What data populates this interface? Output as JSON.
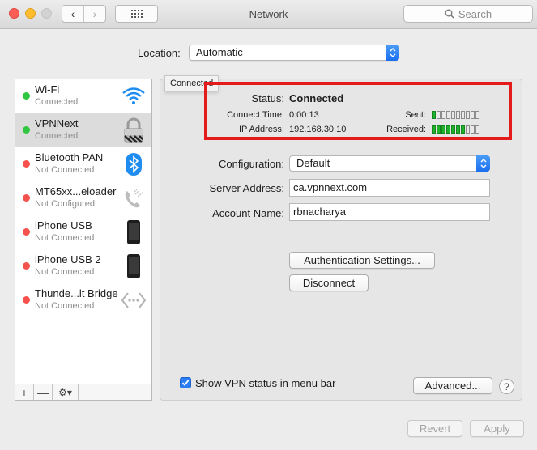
{
  "window": {
    "title": "Network",
    "search_placeholder": "Search",
    "back_glyph": "‹",
    "forward_glyph": "›"
  },
  "location": {
    "label": "Location:",
    "value": "Automatic"
  },
  "tooltip": "Connected",
  "services": [
    {
      "name": "Wi-Fi",
      "status": "Connected",
      "state": "green",
      "icon": "wifi-icon"
    },
    {
      "name": "VPNNext",
      "status": "Connected",
      "state": "green",
      "icon": "lock-icon",
      "selected": true
    },
    {
      "name": "Bluetooth PAN",
      "status": "Not Connected",
      "state": "red",
      "icon": "bluetooth-icon"
    },
    {
      "name": "MT65xx...eloader",
      "status": "Not Configured",
      "state": "red",
      "icon": "phone-icon"
    },
    {
      "name": "iPhone USB",
      "status": "Not Connected",
      "state": "red",
      "icon": "iphone-icon"
    },
    {
      "name": "iPhone USB 2",
      "status": "Not Connected",
      "state": "red",
      "icon": "iphone-icon"
    },
    {
      "name": "Thunde...lt Bridge",
      "status": "Not Connected",
      "state": "red",
      "icon": "thunderbolt-bridge-icon"
    }
  ],
  "sidebar_buttons": {
    "add": "+",
    "remove": "—",
    "gear": "⚙▾"
  },
  "status": {
    "status_label": "Status:",
    "status_value": "Connected",
    "connect_time_label": "Connect Time:",
    "connect_time_value": "0:00:13",
    "ip_label": "IP Address:",
    "ip_value": "192.168.30.10",
    "sent_label": "Sent:",
    "received_label": "Received:",
    "sent_level": 1,
    "received_level": 7,
    "meter_segments": 10
  },
  "config": {
    "configuration_label": "Configuration:",
    "configuration_value": "Default",
    "server_label": "Server Address:",
    "server_value": "ca.vpnnext.com",
    "account_label": "Account Name:",
    "account_value": "rbnacharya"
  },
  "buttons": {
    "auth_settings": "Authentication Settings...",
    "disconnect": "Disconnect",
    "show_vpn_status": "Show VPN status in menu bar",
    "advanced": "Advanced...",
    "help": "?",
    "revert": "Revert",
    "apply": "Apply"
  },
  "colors": {
    "connected": "#2fc740",
    "not_connected": "#f5514d",
    "highlight_box": "#e51b1b",
    "accent": "#2a7df2"
  }
}
